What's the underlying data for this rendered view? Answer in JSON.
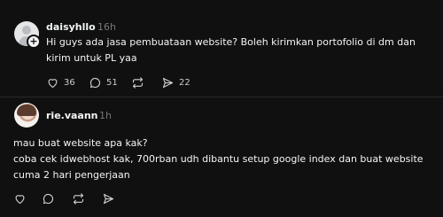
{
  "posts": [
    {
      "username": "daisyhllo",
      "time": "16h",
      "text_lines": [
        "Hi guys ada jasa pembuataan website? Boleh kirimkan portofolio di dm dan",
        "kirim untuk PL yaa"
      ],
      "likes": "36",
      "comments": "51",
      "shares": "22",
      "avatar_icon": "default-user-avatar",
      "badge_icon": "plus-icon"
    },
    {
      "username": "rie.vaann",
      "time": "1h",
      "text_lines": [
        "mau buat website apa kak?",
        "coba cek idwebhost kak, 700rban udh dibantu setup google index dan buat website",
        "cuma 2 hari pengerjaan"
      ],
      "avatar_icon": "profile-photo-avatar"
    }
  ]
}
